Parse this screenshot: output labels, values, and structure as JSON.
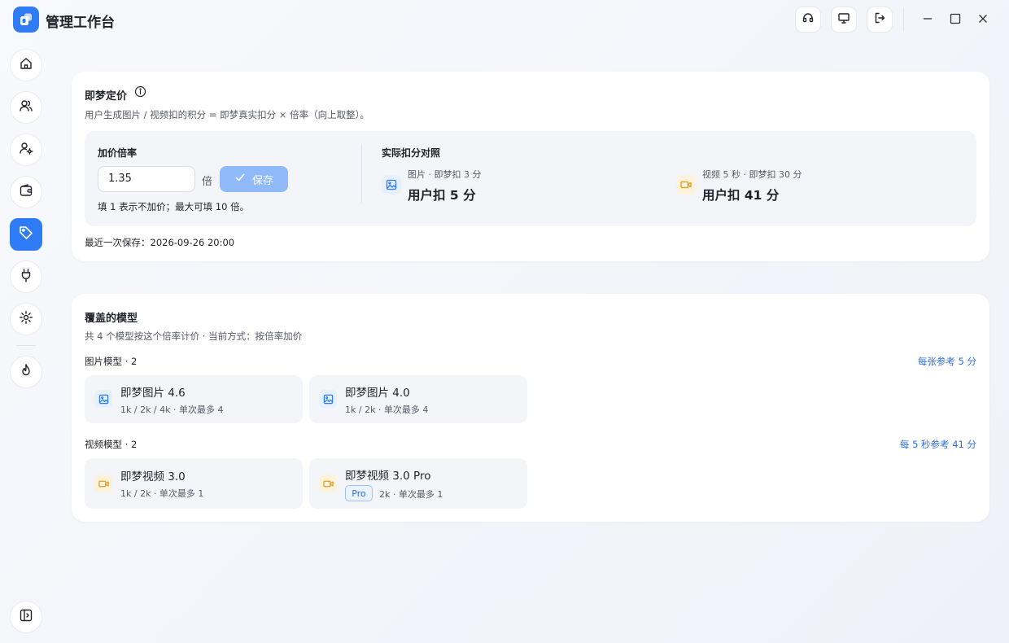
{
  "app": {
    "title": "管理工作台"
  },
  "pricing": {
    "title": "即梦定价",
    "subtitle": "用户生成图片 / 视频扣的积分 = 即梦真实扣分 × 倍率（向上取整）。",
    "rate_label": "加价倍率",
    "rate_value": "1.35",
    "unit": "倍",
    "save_label": "保存",
    "hint": "填 1 表示不加价；最大可填 10 倍。",
    "compare_title": "实际扣分对照",
    "image_compare": {
      "small": "图片 · 即梦扣 3 分",
      "big": "用户扣 5 分",
      "icon": "image-icon"
    },
    "video_compare": {
      "small": "视频 5 秒 · 即梦扣 30 分",
      "big": "用户扣 41 分",
      "icon": "video-icon"
    },
    "last_saved": "最近一次保存：2026-09-26 20:00"
  },
  "models": {
    "title": "覆盖的模型",
    "subtitle": "共 4 个模型按这个倍率计价 · 当前方式：按倍率加价",
    "image_group": {
      "label": "图片模型 · 2",
      "ref": "每张参考 5 分",
      "items": [
        {
          "name": "即梦图片 4.6",
          "meta": "1k / 2k / 4k · 单次最多 4"
        },
        {
          "name": "即梦图片 4.0",
          "meta": "1k / 2k · 单次最多 4"
        }
      ]
    },
    "video_group": {
      "label": "视频模型 · 2",
      "ref": "每 5 秒参考 41 分",
      "items": [
        {
          "name": "即梦视频 3.0",
          "meta": "1k / 2k · 单次最多 1"
        },
        {
          "name": "即梦视频 3.0 Pro",
          "badge": "Pro",
          "meta": "2k · 单次最多 1"
        }
      ]
    }
  },
  "colors": {
    "accent": "#2f7bf5",
    "image_icon": "#2f7bf5",
    "video_icon": "#e29a12"
  }
}
